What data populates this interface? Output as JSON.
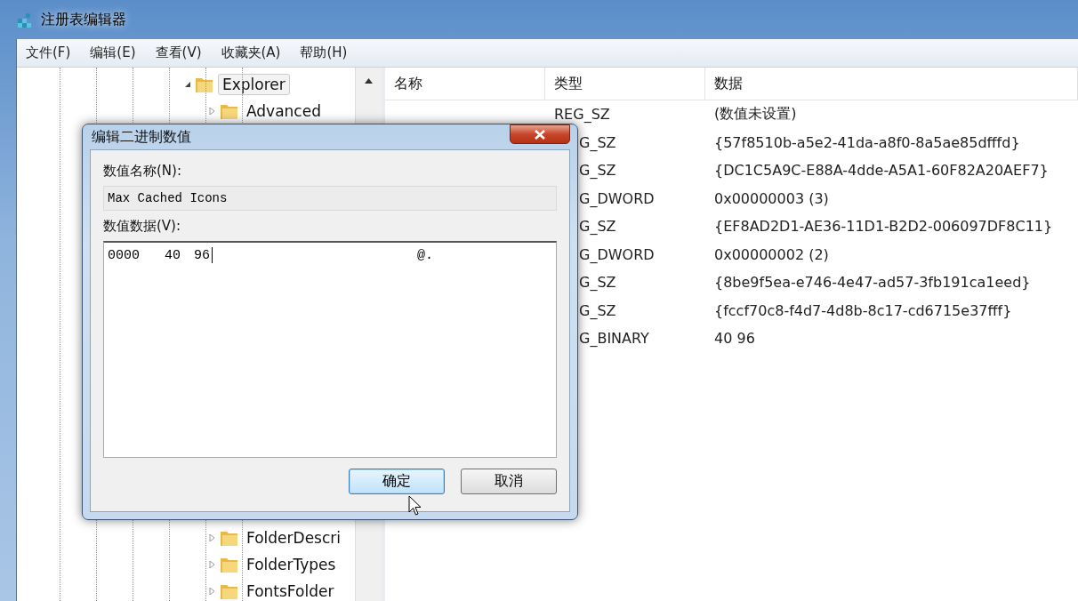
{
  "window": {
    "title": "注册表编辑器"
  },
  "menu": [
    {
      "label": "文件(F)"
    },
    {
      "label": "编辑(E)"
    },
    {
      "label": "查看(V)"
    },
    {
      "label": "收藏夹(A)"
    },
    {
      "label": "帮助(H)"
    }
  ],
  "tree": [
    {
      "label": "Explorer",
      "expanded": true,
      "selected": true,
      "children": [
        {
          "label": "Advanced",
          "expanded": false,
          "selected": false
        },
        {
          "label": "FolderDescri",
          "expanded": false,
          "selected": false
        },
        {
          "label": "FolderTypes",
          "expanded": false,
          "selected": false
        },
        {
          "label": "FontsFolder",
          "expanded": false,
          "selected": false
        }
      ]
    }
  ],
  "list": {
    "columns": [
      "名称",
      "类型",
      "数据"
    ],
    "rows": [
      {
        "type": "REG_SZ",
        "clipped": false,
        "data": "(数值未设置)"
      },
      {
        "type": "G_SZ",
        "clipped": true,
        "data": "{57f8510b-a5e2-41da-a8f0-8a5ae85dfffd}"
      },
      {
        "type": "G_SZ",
        "clipped": true,
        "data": "{DC1C5A9C-E88A-4dde-A5A1-60F82A20AEF7}"
      },
      {
        "type": "G_DWORD",
        "clipped": true,
        "data": "0x00000003 (3)"
      },
      {
        "type": "G_SZ",
        "clipped": true,
        "data": "{EF8AD2D1-AE36-11D1-B2D2-006097DF8C11}"
      },
      {
        "type": "G_DWORD",
        "clipped": true,
        "data": "0x00000002 (2)"
      },
      {
        "type": "G_SZ",
        "clipped": true,
        "data": "{8be9f5ea-e746-4e47-ad57-3fb191ca1eed}"
      },
      {
        "type": "G_SZ",
        "clipped": true,
        "data": "{fccf70c8-f4d7-4d8b-8c17-cd6715e37fff}"
      },
      {
        "type": "G_BINARY",
        "clipped": true,
        "data": "40 96"
      }
    ]
  },
  "dialog": {
    "title": "编辑二进制数值",
    "name_label": "数值名称(N):",
    "name_value": "Max Cached Icons",
    "data_label": "数值数据(V):",
    "hex": {
      "address": "0000",
      "bytes": "40 96",
      "ascii": "@."
    },
    "buttons": [
      {
        "label": "确定",
        "selected": true
      },
      {
        "label": "取消",
        "selected": false
      }
    ]
  }
}
